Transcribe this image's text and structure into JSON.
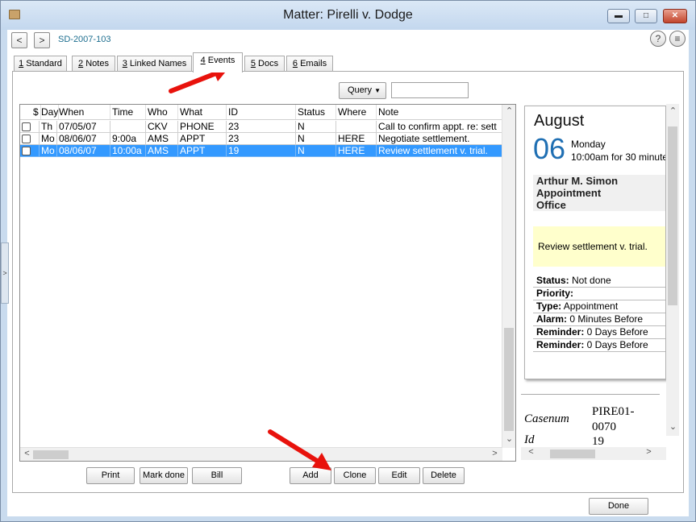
{
  "window": {
    "title": "Matter: Pirelli v. Dodge"
  },
  "nav": {
    "back": "<",
    "forward": ">",
    "matter_id": "SD-2007-103",
    "help": "?",
    "menu": "≡"
  },
  "tabs": [
    {
      "num": "1",
      "label": " Standard"
    },
    {
      "num": "2",
      "label": " Notes"
    },
    {
      "num": "3",
      "label": " Linked Names"
    },
    {
      "num": "4",
      "label": " Events"
    },
    {
      "num": "5",
      "label": " Docs"
    },
    {
      "num": "6",
      "label": " Emails"
    }
  ],
  "active_tab": "4 Events",
  "query": {
    "label": "Query",
    "value": ""
  },
  "grid": {
    "columns": [
      "$",
      "Day",
      "When",
      "Time",
      "Who",
      "What",
      "ID",
      "Status",
      "Where",
      "Note"
    ],
    "rows": [
      {
        "day": "Th",
        "when": "07/05/07",
        "time": "",
        "who": "CKV",
        "what": "PHONE",
        "id": "23",
        "status": "N",
        "where": "",
        "note": "Call to confirm appt. re: sett",
        "selected": false
      },
      {
        "day": "Mo",
        "when": "08/06/07",
        "time": "9:00a",
        "who": "AMS",
        "what": "APPT",
        "id": "23",
        "status": "N",
        "where": "HERE",
        "note": "Negotiate settlement.",
        "selected": false
      },
      {
        "day": "Mo",
        "when": "08/06/07",
        "time": "10:00a",
        "who": "AMS",
        "what": "APPT",
        "id": "19",
        "status": "N",
        "where": "HERE",
        "note": "Review settlement v. trial.",
        "selected": true
      }
    ]
  },
  "detail": {
    "month": "August",
    "day_number": "06",
    "weekday": "Monday",
    "time_info": "10:00am for 30 minute",
    "person": "Arthur M. Simon",
    "type_band": "Appointment",
    "place_band": "Office",
    "note": "Review settlement v. trial.",
    "props": [
      {
        "key": "Status:",
        "value": " Not done"
      },
      {
        "key": "Priority:",
        "value": ""
      },
      {
        "key": "Type:",
        "value": " Appointment"
      },
      {
        "key": "Alarm:",
        "value": " 0 Minutes Before"
      },
      {
        "key": "Reminder:",
        "value": " 0 Days Before"
      },
      {
        "key": "Reminder:",
        "value": " 0 Days Before"
      }
    ],
    "casenum_label": "Casenum",
    "casenum_value_1": "PIRE01-",
    "casenum_value_2": "0070",
    "id_label": "Id",
    "id_value": "19"
  },
  "buttons": {
    "print": "Print",
    "mark_done": "Mark done",
    "bill": "Bill",
    "add": "Add",
    "clone": "Clone",
    "edit": "Edit",
    "delete": "Delete",
    "done": "Done"
  },
  "edge_tab": ">",
  "colors": {
    "selection": "#3399ff",
    "accent_day": "#1f6fb3",
    "note_bg": "#ffffcc",
    "arrow": "#e8120c"
  }
}
